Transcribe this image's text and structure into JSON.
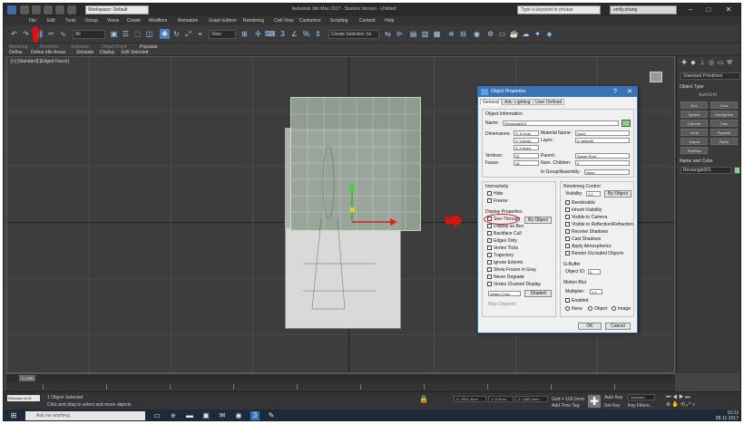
{
  "window": {
    "title": "Autodesk 3ds Max 2017 - Student Version - Untitled",
    "workspace": "Workspace: Default",
    "search_placeholder": "Type a keyword or phrase",
    "user": "emily.zhang",
    "controls": [
      "–",
      "□",
      "✕"
    ]
  },
  "menu": [
    "File",
    "Edit",
    "Tools",
    "Group",
    "Views",
    "Create",
    "Modifiers",
    "Animation",
    "Graph Editors",
    "Rendering",
    "Civil View",
    "Customize",
    "Scripting",
    "Content",
    "Help"
  ],
  "toolbar": {
    "selection_filter": "All",
    "view_dropdown": "View",
    "selection_set": "Create Selection Se"
  },
  "ribbon": {
    "tabs": [
      "Modeling",
      "Freeform",
      "Selection",
      "Object Paint",
      "Populate"
    ],
    "items": [
      "Define",
      "Define Idle Areas",
      "Simulate",
      "Display",
      "Edit Selected"
    ]
  },
  "viewport": {
    "label": "[+] [Standard] [Edged Faces]"
  },
  "command_panel": {
    "dropdown": "Standard Primitives",
    "object_type_header": "Object Type",
    "autogrid": "AutoGrid",
    "buttons": [
      "Box",
      "Cone",
      "Sphere",
      "GeoSphere",
      "Cylinder",
      "Tube",
      "Torus",
      "Pyramid",
      "Teapot",
      "Plane",
      "TextPlus"
    ],
    "name_color_header": "Name and Color",
    "name_value": "Rectangle001"
  },
  "dialog": {
    "title": "Object Properties",
    "tabs": [
      "General",
      "Adv. Lighting",
      "User Defined"
    ],
    "object_info_header": "Object Information",
    "name_label": "Name:",
    "name_value": "Rectangle001",
    "dimensions_label": "Dimensions:",
    "dim_x": "X: 0.0mm",
    "dim_y": "Y: 0.0mm",
    "dim_z": "Z: 0.0mm",
    "material_name_label": "Material Name:",
    "material_name_value": "None",
    "layer_label": "Layer:",
    "layer_value": "0 (default)",
    "vertices_label": "Vertices:",
    "vertices_value": "32",
    "faces_label": "Faces:",
    "faces_value": "48",
    "parent_label": "Parent:",
    "parent_value": "Scene Root",
    "num_children_label": "Num. Children:",
    "num_children_value": "0",
    "in_group_label": "In Group/Assembly:",
    "in_group_value": "None",
    "interactivity_header": "Interactivity",
    "interactivity": [
      "Hide",
      "Freeze"
    ],
    "display_props_header": "Display Properties",
    "display_props": [
      "See-Through",
      "Display as Box",
      "Backface Cull",
      "Edges Only",
      "Vertex Ticks",
      "Trajectory",
      "Ignore Extents",
      "Show Frozen in Gray",
      "Never Degrade",
      "Vertex Channel Display"
    ],
    "by_object": "By Object",
    "vertex_color": "Vertex Color",
    "shaded": "Shaded",
    "map_channel": "Map Channel:",
    "rendering_control_header": "Rendering Control",
    "visibility_label": "Visibility:",
    "visibility_value": "1.0",
    "by_layer": "By Object",
    "rendering": [
      "Renderable",
      "Inherit Visibility",
      "Visible to Camera",
      "Visible to Reflection/Refraction",
      "Receive Shadows",
      "Cast Shadows",
      "Apply Atmospherics",
      "Render Occluded Objects"
    ],
    "gbuffer_header": "G-Buffer",
    "object_id_label": "Object ID:",
    "object_id_value": "0",
    "motion_blur_header": "Motion Blur",
    "multiplier_label": "Multiplier:",
    "multiplier_value": "1.0",
    "enabled": "Enabled",
    "blur_types": [
      "None",
      "Object",
      "Image"
    ],
    "ok": "OK",
    "cancel": "Cancel"
  },
  "trackbar": {
    "slider": "0 / 100"
  },
  "status": {
    "selection": "1 Object Selected",
    "prompt": "Click and drag to select and move objects",
    "maxscript": "Welcome to M",
    "x": "X: 1501.3mm",
    "y": "Y: 0.0mm",
    "z": "Z: 2280.4mm",
    "grid": "Grid = 100.0mm",
    "add_time_tag": "Add Time Tag",
    "autokey": "Auto Key",
    "selected": "Selected",
    "setkey": "Set Key",
    "key_filters": "Key Filters..."
  },
  "taskbar": {
    "search_placeholder": "Ask me anything",
    "time": "10:23",
    "date": "08-11-2017"
  },
  "colors": {
    "annotation_red": "#e01010",
    "dialog_title": "#3972b5",
    "viewport_bg": "#3d3d3d"
  }
}
